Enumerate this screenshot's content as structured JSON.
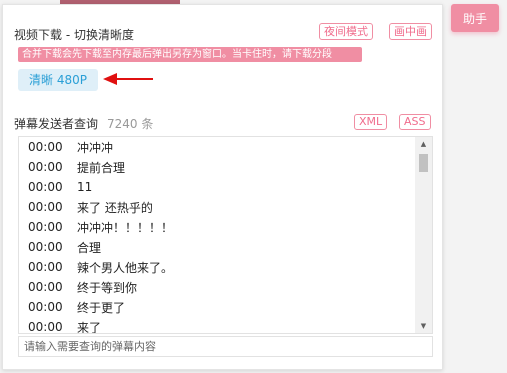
{
  "helper_button": "助手",
  "download": {
    "title": "视频下载 - 切换清晰度",
    "night_mode": "夜间模式",
    "pip": "画中画",
    "notice": "合并下载会先下载至内存最后弹出另存为窗口。当卡住时，请下载分段",
    "quality": "清晰 480P"
  },
  "danmaku": {
    "title": "弹幕发送者查询",
    "count": "7240 条",
    "xml": "XML",
    "ass": "ASS",
    "rows": [
      {
        "time": "00:00",
        "text": "冲冲冲"
      },
      {
        "time": "00:00",
        "text": "提前合理"
      },
      {
        "time": "00:00",
        "text": "11"
      },
      {
        "time": "00:00",
        "text": "来了 还热乎的"
      },
      {
        "time": "00:00",
        "text": "冲冲冲！！！！！"
      },
      {
        "time": "00:00",
        "text": "合理"
      },
      {
        "time": "00:00",
        "text": "辣个男人他来了。"
      },
      {
        "time": "00:00",
        "text": "终于等到你"
      },
      {
        "time": "00:00",
        "text": "终于更了"
      },
      {
        "time": "00:00",
        "text": "来了"
      }
    ],
    "search_placeholder": "请输入需要查询的弹幕内容"
  },
  "colors": {
    "accent_pink": "#f08ea3",
    "quality_blue": "#2a9fd6",
    "arrow_red": "#e01010"
  },
  "icons": {
    "arrow": "red-left-arrow",
    "scroll_up": "triangle-up",
    "scroll_down": "triangle-down"
  }
}
